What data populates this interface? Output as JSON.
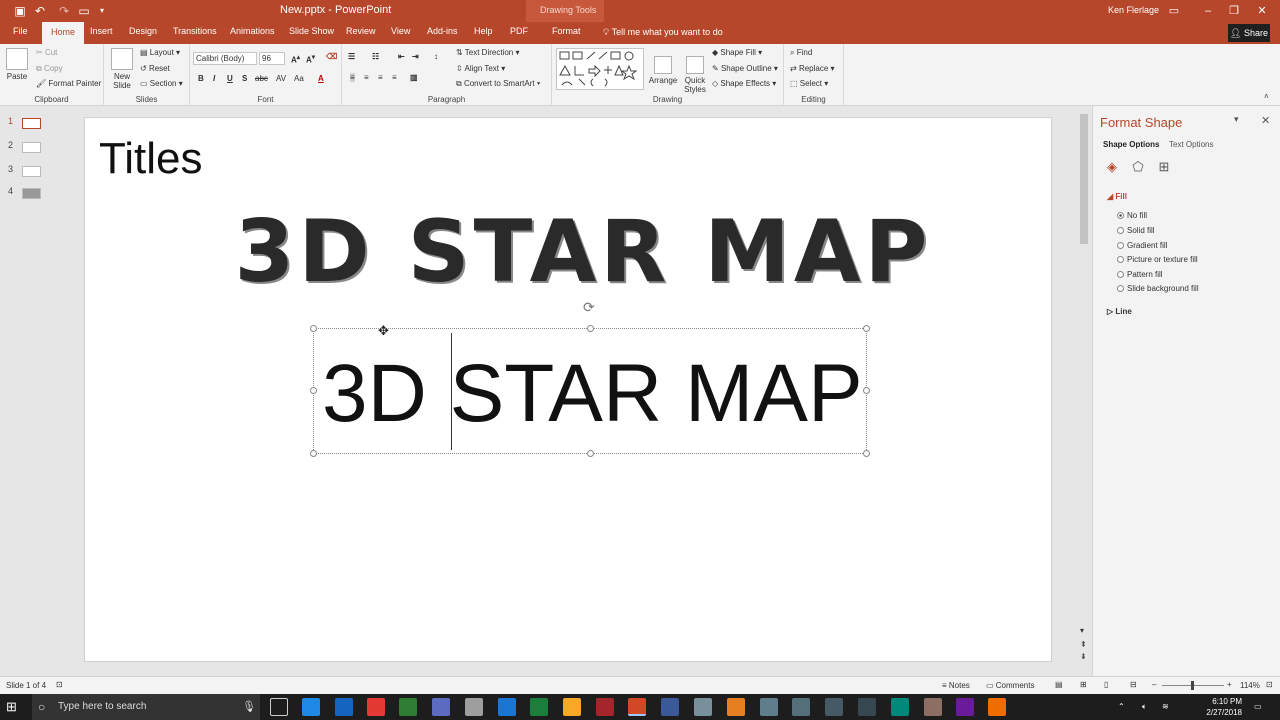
{
  "titlebar": {
    "document_title": "New.pptx - PowerPoint",
    "context_group": "Drawing Tools",
    "user_name": "Ken Flerlage"
  },
  "tabs": [
    {
      "label": "File"
    },
    {
      "label": "Home"
    },
    {
      "label": "Insert"
    },
    {
      "label": "Design"
    },
    {
      "label": "Transitions"
    },
    {
      "label": "Animations"
    },
    {
      "label": "Slide Show"
    },
    {
      "label": "Review"
    },
    {
      "label": "View"
    },
    {
      "label": "Add-ins"
    },
    {
      "label": "Help"
    },
    {
      "label": "PDF"
    },
    {
      "label": "Format"
    }
  ],
  "tell_me": "Tell me what you want to do",
  "share_label": "Share",
  "ribbon": {
    "clipboard": {
      "label": "Clipboard",
      "paste": "Paste",
      "cut": "Cut",
      "copy": "Copy",
      "format_painter": "Format Painter"
    },
    "slides": {
      "label": "Slides",
      "new_slide": "New Slide",
      "layout": "Layout",
      "reset": "Reset",
      "section": "Section"
    },
    "font": {
      "label": "Font",
      "font_name": "Calibri (Body)",
      "font_size": "96"
    },
    "paragraph": {
      "label": "Paragraph",
      "text_direction": "Text Direction",
      "align_text": "Align Text",
      "convert_smartart": "Convert to SmartArt"
    },
    "drawing": {
      "label": "Drawing",
      "arrange": "Arrange",
      "quick_styles": "Quick Styles",
      "shape_fill": "Shape Fill",
      "shape_outline": "Shape Outline",
      "shape_effects": "Shape Effects"
    },
    "editing": {
      "label": "Editing",
      "find": "Find",
      "replace": "Replace",
      "select": "Select"
    }
  },
  "thumbnails": [
    {
      "number": "1"
    },
    {
      "number": "2"
    },
    {
      "number": "3"
    },
    {
      "number": "4"
    }
  ],
  "slide": {
    "title": "Titles",
    "wordart_text": "3D STAR MAP",
    "textbox_text": "3D STAR MAP"
  },
  "format_pane": {
    "title": "Format Shape",
    "tab_shape": "Shape Options",
    "tab_text": "Text Options",
    "fill_section": "Fill",
    "fill_options": [
      {
        "label": "No fill",
        "selected": true
      },
      {
        "label": "Solid fill",
        "selected": false
      },
      {
        "label": "Gradient fill",
        "selected": false
      },
      {
        "label": "Picture or texture fill",
        "selected": false
      },
      {
        "label": "Pattern fill",
        "selected": false
      },
      {
        "label": "Slide background fill",
        "selected": false
      }
    ],
    "line_section": "Line"
  },
  "status": {
    "slide_info": "Slide 1 of 4",
    "notes": "Notes",
    "comments": "Comments",
    "zoom": "114%"
  },
  "taskbar": {
    "search_placeholder": "Type here to search",
    "time": "6:10 PM",
    "date": "2/27/2018"
  },
  "colors": {
    "accent": "#b7472a",
    "taskbar": "#1d1d1d"
  }
}
